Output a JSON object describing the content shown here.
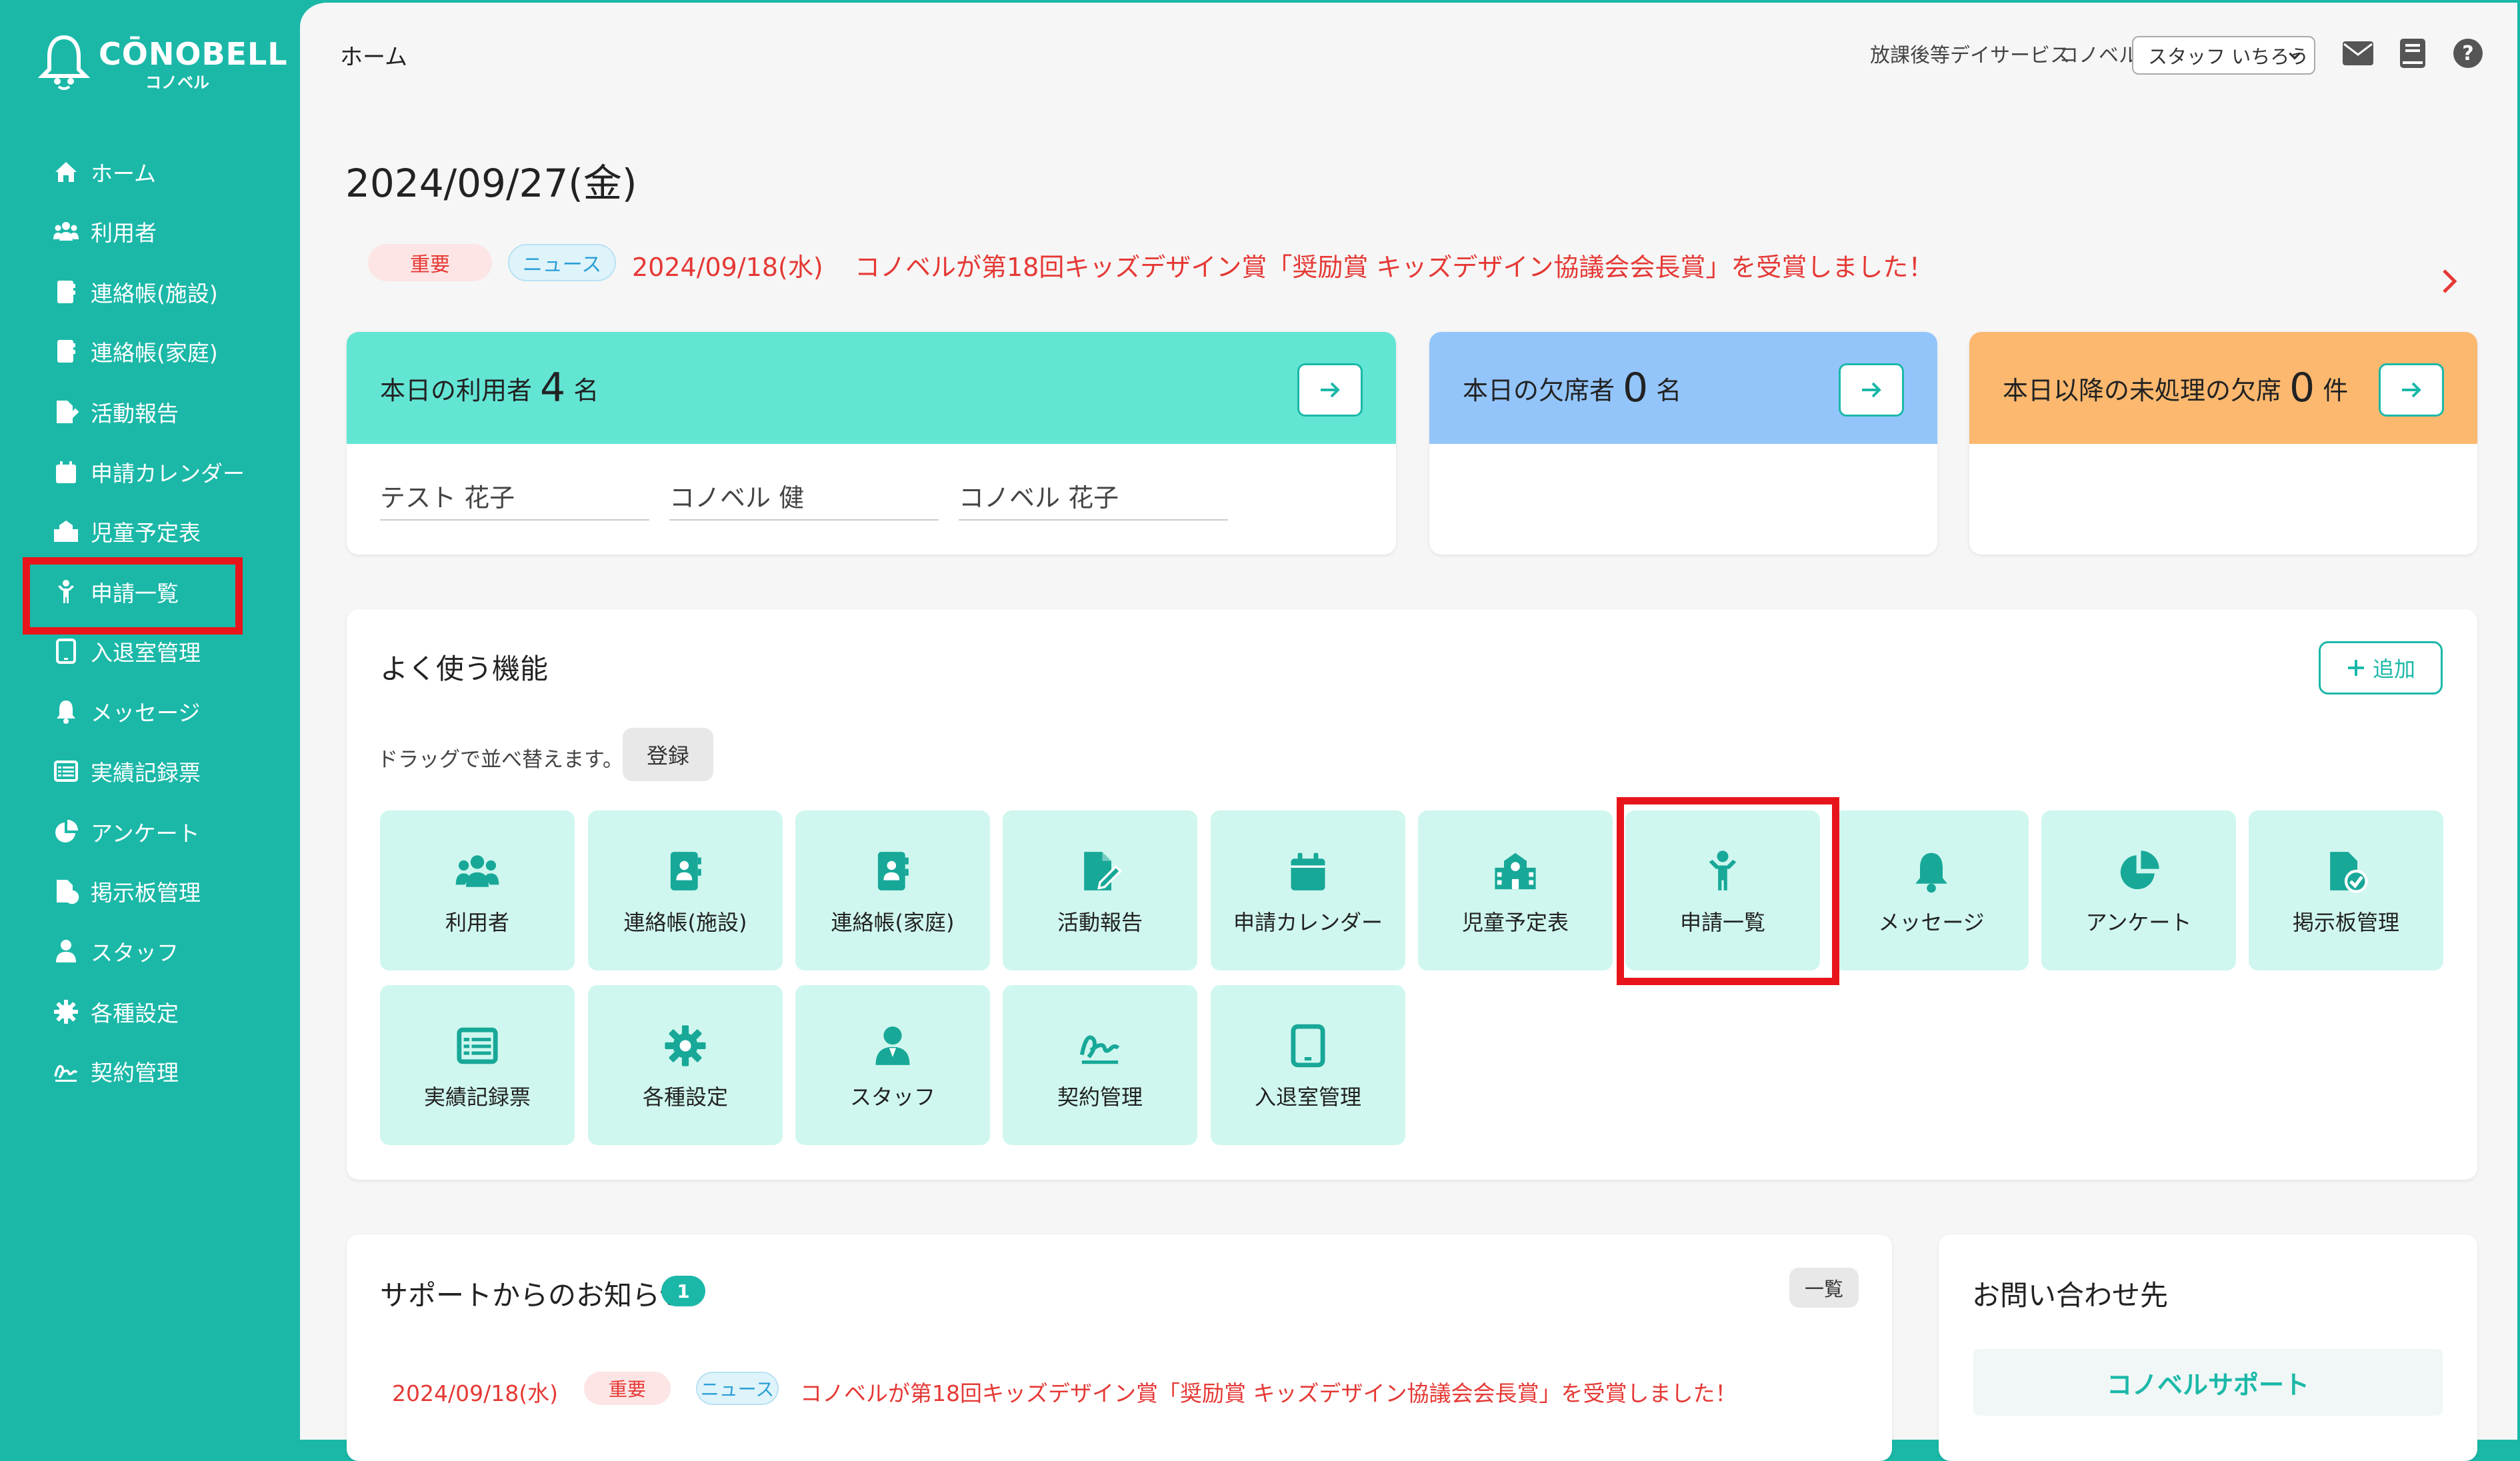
{
  "brand": {
    "name": "CŌNOBELL",
    "sub": "コノベル",
    "accent": "#1bb8a8",
    "highlight": "#e8141b"
  },
  "sidebar": {
    "items": [
      {
        "label": "ホーム",
        "icon": "home-icon"
      },
      {
        "label": "利用者",
        "icon": "users-icon"
      },
      {
        "label": "連絡帳(施設)",
        "icon": "contact-book-icon"
      },
      {
        "label": "連絡帳(家庭)",
        "icon": "contact-book-icon"
      },
      {
        "label": "活動報告",
        "icon": "report-edit-icon"
      },
      {
        "label": "申請カレンダー",
        "icon": "calendar-icon"
      },
      {
        "label": "児童予定表",
        "icon": "school-icon"
      },
      {
        "label": "申請一覧",
        "icon": "child-icon"
      },
      {
        "label": "入退室管理",
        "icon": "tablet-icon"
      },
      {
        "label": "メッセージ",
        "icon": "bell-icon"
      },
      {
        "label": "実績記録票",
        "icon": "list-table-icon"
      },
      {
        "label": "アンケート",
        "icon": "pie-chart-icon"
      },
      {
        "label": "掲示板管理",
        "icon": "file-check-icon"
      },
      {
        "label": "スタッフ",
        "icon": "staff-icon"
      },
      {
        "label": "各種設定",
        "icon": "gear-icon"
      },
      {
        "label": "契約管理",
        "icon": "signature-icon"
      }
    ]
  },
  "topbar": {
    "title": "ホーム",
    "facility_type": "放課後等デイサービス",
    "facility_name": "コノベル",
    "staff_name": "スタッフ いちろう"
  },
  "date": "2024/09/27(金)",
  "news_banner": {
    "tag_important": "重要",
    "tag_news": "ニュース",
    "date": "2024/09/18(水)",
    "text": "コノベルが第18回キッズデザイン賞「奨励賞 キッズデザイン協議会会長賞」を受賞しました！"
  },
  "summary": {
    "today_users": {
      "label": "本日の利用者",
      "count": "4",
      "unit": "名",
      "names": [
        "テスト 花子",
        "コノベル 健",
        "コノベル 花子"
      ],
      "color": "#63e5d4"
    },
    "today_absent": {
      "label": "本日の欠席者",
      "count": "0",
      "unit": "名",
      "color": "#93c5fb"
    },
    "pending_absent": {
      "label": "本日以降の未処理の欠席",
      "count": "0",
      "unit": "件",
      "color": "#fbb86e"
    }
  },
  "favorites": {
    "title": "よく使う機能",
    "add_label": "追加",
    "hint": "ドラッグで並べ替えます。",
    "register_label": "登録",
    "tiles": [
      {
        "label": "利用者",
        "icon": "users-icon"
      },
      {
        "label": "連絡帳(施設)",
        "icon": "contact-book-icon"
      },
      {
        "label": "連絡帳(家庭)",
        "icon": "contact-book-icon"
      },
      {
        "label": "活動報告",
        "icon": "report-edit-icon"
      },
      {
        "label": "申請カレンダー",
        "icon": "calendar-icon"
      },
      {
        "label": "児童予定表",
        "icon": "school-icon"
      },
      {
        "label": "申請一覧",
        "icon": "child-icon"
      },
      {
        "label": "メッセージ",
        "icon": "bell-icon"
      },
      {
        "label": "アンケート",
        "icon": "pie-chart-icon"
      },
      {
        "label": "掲示板管理",
        "icon": "file-check-icon"
      },
      {
        "label": "実績記録票",
        "icon": "list-table-icon"
      },
      {
        "label": "各種設定",
        "icon": "gear-icon"
      },
      {
        "label": "スタッフ",
        "icon": "staff-icon"
      },
      {
        "label": "契約管理",
        "icon": "signature-icon"
      },
      {
        "label": "入退室管理",
        "icon": "tablet-icon"
      }
    ]
  },
  "support": {
    "title": "サポートからのお知らせ",
    "count": "1",
    "list_label": "一覧",
    "item": {
      "date": "2024/09/18(水)",
      "tag_important": "重要",
      "tag_news": "ニュース",
      "text": "コノベルが第18回キッズデザイン賞「奨励賞 キッズデザイン協議会会長賞」を受賞しました！"
    }
  },
  "contact": {
    "title": "お問い合わせ先",
    "support_label": "コノベルサポート"
  }
}
